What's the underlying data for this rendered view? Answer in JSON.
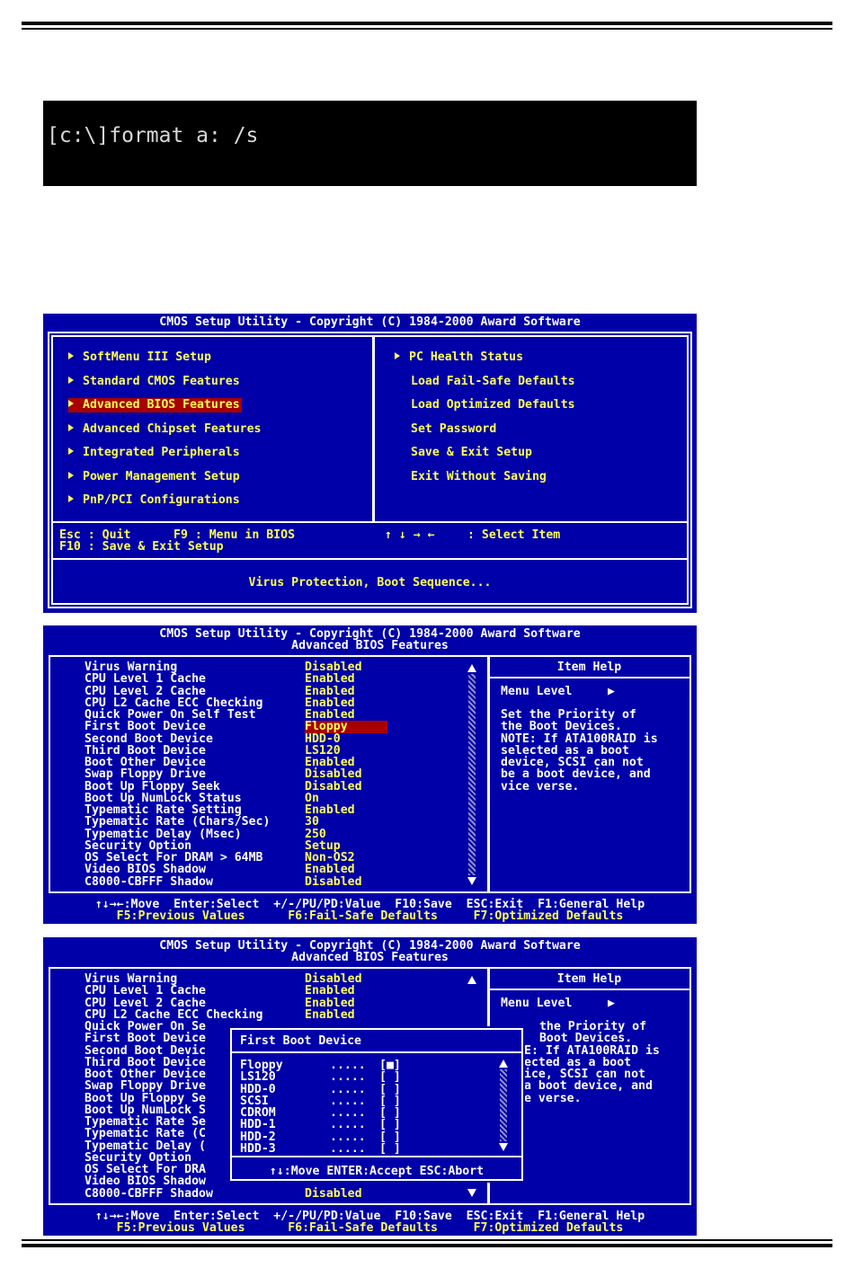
{
  "terminal": {
    "command": "[c:\\]format a: /s"
  },
  "main_menu": {
    "title": "CMOS Setup Utility - Copyright (C) 1984-2000 Award Software",
    "left_items": [
      {
        "label": "SoftMenu III Setup",
        "arrow": true,
        "selected": false
      },
      {
        "label": "Standard CMOS Features",
        "arrow": true,
        "selected": false
      },
      {
        "label": "Advanced BIOS Features",
        "arrow": true,
        "selected": true
      },
      {
        "label": "Advanced Chipset Features",
        "arrow": true,
        "selected": false
      },
      {
        "label": "Integrated Peripherals",
        "arrow": true,
        "selected": false
      },
      {
        "label": "Power Management Setup",
        "arrow": true,
        "selected": false
      },
      {
        "label": "PnP/PCI Configurations",
        "arrow": true,
        "selected": false
      }
    ],
    "right_items": [
      {
        "label": "PC Health Status",
        "arrow": true
      },
      {
        "label": "Load Fail-Safe Defaults",
        "arrow": false
      },
      {
        "label": "Load Optimized Defaults",
        "arrow": false
      },
      {
        "label": "Set Password",
        "arrow": false
      },
      {
        "label": "Save & Exit Setup",
        "arrow": false
      },
      {
        "label": "Exit Without Saving",
        "arrow": false
      }
    ],
    "keys_line1_left": "Esc : Quit      F9 : Menu in BIOS",
    "keys_line1_right": ": Select Item",
    "keys_arrows": "↑ ↓ → ←",
    "keys_line2": "F10 : Save & Exit Setup",
    "description": "Virus Protection, Boot Sequence..."
  },
  "adv": {
    "title": "CMOS Setup Utility - Copyright (C) 1984-2000 Award Software",
    "subtitle": "Advanced BIOS Features",
    "settings": [
      {
        "name": "Virus Warning",
        "value": "Disabled"
      },
      {
        "name": "CPU Level 1 Cache",
        "value": "Enabled"
      },
      {
        "name": "CPU Level 2 Cache",
        "value": "Enabled"
      },
      {
        "name": "CPU L2 Cache ECC Checking",
        "value": "Enabled"
      },
      {
        "name": "Quick Power On Self Test",
        "value": "Enabled"
      },
      {
        "name": "First Boot Device",
        "value": "Floppy"
      },
      {
        "name": "Second Boot Device",
        "value": "HDD-0"
      },
      {
        "name": "Third Boot Device",
        "value": "LS120"
      },
      {
        "name": "Boot Other Device",
        "value": "Enabled"
      },
      {
        "name": "Swap Floppy Drive",
        "value": "Disabled"
      },
      {
        "name": "Boot Up Floppy Seek",
        "value": "Disabled"
      },
      {
        "name": "Boot Up NumLock Status",
        "value": "On"
      },
      {
        "name": "Typematic Rate Setting",
        "value": "Enabled"
      },
      {
        "name": "Typematic Rate (Chars/Sec)",
        "value": "30"
      },
      {
        "name": "Typematic Delay (Msec)",
        "value": "250"
      },
      {
        "name": "Security Option",
        "value": "Setup"
      },
      {
        "name": "OS Select For DRAM > 64MB",
        "value": "Non-OS2"
      },
      {
        "name": "Video BIOS Shadow",
        "value": "Enabled"
      },
      {
        "name": "C8000-CBFFF Shadow",
        "value": "Disabled"
      }
    ],
    "item_help_title": "Item Help",
    "menu_level": "Menu Level",
    "menu_level_arrow": "▶",
    "help_lines": [
      "Set the Priority of",
      "the Boot Devices.",
      "NOTE: If ATA100RAID is",
      "selected as a boot",
      "device, SCSI can not",
      "be a boot device, and",
      "vice verse."
    ],
    "footer1": "↑↓→←:Move  Enter:Select  +/-/PU/PD:Value  F10:Save  ESC:Exit  F1:General Help",
    "footer2": "F5:Previous Values      F6:Fail-Safe Defaults     F7:Optimized Defaults"
  },
  "adv2": {
    "title": "CMOS Setup Utility - Copyright (C) 1984-2000 Award Software",
    "subtitle": "Advanced BIOS Features",
    "settings_visible": [
      {
        "name": "Virus Warning",
        "value": "Disabled"
      },
      {
        "name": "CPU Level 1 Cache",
        "value": "Enabled"
      },
      {
        "name": "CPU Level 2 Cache",
        "value": "Enabled"
      },
      {
        "name": "CPU L2 Cache ECC Checking",
        "value": "Enabled"
      }
    ],
    "settings_partial": [
      "Quick Power On Se",
      "First Boot Device",
      "Second Boot Devic",
      "Third Boot Device",
      "Boot Other Device",
      "Swap Floppy Drive",
      "Boot Up Floppy Se",
      "Boot Up NumLock S",
      "Typematic Rate Se",
      "Typematic Rate (C",
      "Typematic Delay (",
      "Security Option",
      "OS Select For DRA",
      "Video BIOS Shadow"
    ],
    "last_setting": {
      "name": "C8000-CBFFF Shadow",
      "value": "Disabled"
    },
    "item_help_title": "Item Help",
    "menu_level": "Menu Level",
    "menu_level_arrow": "▶",
    "help_partial": [
      " the Priority of",
      " Boot Devices.",
      "E: If ATA100RAID is",
      "ected as a boot",
      "ice, SCSI can not",
      "a boot device, and",
      "e verse."
    ],
    "popup": {
      "title": "First Boot Device",
      "options": [
        {
          "label": "Floppy",
          "dots": ".....",
          "mark": "[■]"
        },
        {
          "label": "LS120",
          "dots": ".....",
          "mark": "[ ]"
        },
        {
          "label": "HDD-0",
          "dots": ".....",
          "mark": "[ ]"
        },
        {
          "label": "SCSI",
          "dots": ".....",
          "mark": "[ ]"
        },
        {
          "label": "CDROM",
          "dots": ".....",
          "mark": "[ ]"
        },
        {
          "label": "HDD-1",
          "dots": ".....",
          "mark": "[ ]"
        },
        {
          "label": "HDD-2",
          "dots": ".....",
          "mark": "[ ]"
        },
        {
          "label": "HDD-3",
          "dots": ".....",
          "mark": "[ ]"
        }
      ],
      "footer": "↑↓:Move ENTER:Accept ESC:Abort"
    },
    "footer1": "↑↓→←:Move  Enter:Select  +/-/PU/PD:Value  F10:Save  ESC:Exit  F1:General Help",
    "footer2": "F5:Previous Values      F6:Fail-Safe Defaults     F7:Optimized Defaults"
  }
}
